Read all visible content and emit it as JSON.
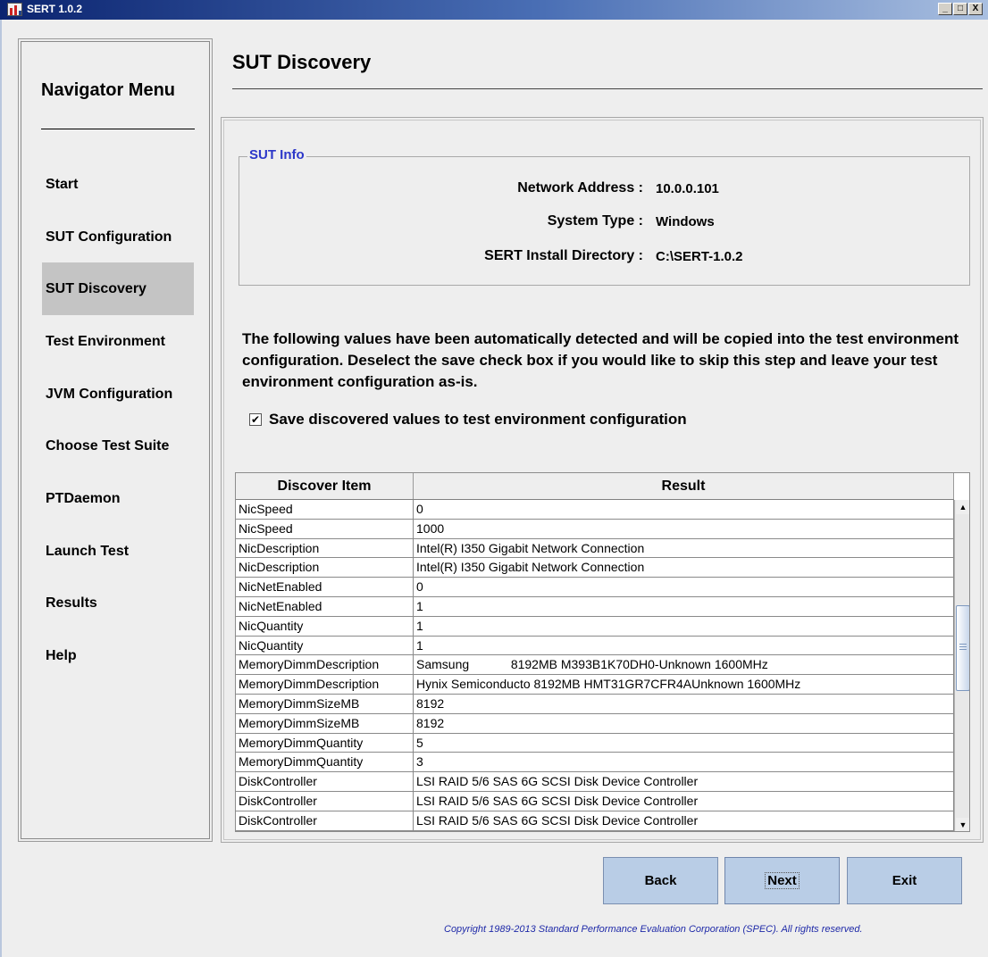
{
  "window": {
    "title": "SERT 1.0.2",
    "minimize": "_",
    "maximize": "□",
    "close": "X"
  },
  "navigator": {
    "heading": "Navigator Menu",
    "items": [
      {
        "label": "Start"
      },
      {
        "label": "SUT Configuration"
      },
      {
        "label": "SUT Discovery"
      },
      {
        "label": "Test Environment"
      },
      {
        "label": "JVM Configuration"
      },
      {
        "label": "Choose Test Suite"
      },
      {
        "label": "PTDaemon"
      },
      {
        "label": "Launch Test"
      },
      {
        "label": "Results"
      },
      {
        "label": "Help"
      }
    ],
    "active_item": "SUT Discovery"
  },
  "page": {
    "title": "SUT Discovery"
  },
  "sut_info": {
    "legend": "SUT Info",
    "network_address_label": "Network Address :",
    "network_address": "10.0.0.101",
    "system_type_label": "System Type :",
    "system_type": "Windows",
    "install_dir_label": "SERT Install Directory :",
    "install_dir": "C:\\SERT-1.0.2"
  },
  "description": "The following values have been automatically detected and will be copied into the test environment configuration. Deselect the save check box if you would like to skip this step and leave your test environment configuration as-is.",
  "save_option": {
    "checked": true,
    "check_mark": "✔",
    "label": "Save discovered values to test environment configuration"
  },
  "table": {
    "columns": [
      "Discover Item",
      "Result"
    ],
    "rows": [
      [
        "NicSpeed",
        "0"
      ],
      [
        "NicSpeed",
        "1000"
      ],
      [
        "NicDescription",
        "Intel(R) I350 Gigabit Network Connection"
      ],
      [
        "NicDescription",
        "Intel(R) I350 Gigabit Network Connection"
      ],
      [
        "NicNetEnabled",
        "0"
      ],
      [
        "NicNetEnabled",
        "1"
      ],
      [
        "NicQuantity",
        "1"
      ],
      [
        "NicQuantity",
        "1"
      ],
      [
        "MemoryDimmDescription",
        "Samsung            8192MB M393B1K70DH0-Unknown 1600MHz"
      ],
      [
        "MemoryDimmDescription",
        "Hynix Semiconducto 8192MB HMT31GR7CFR4AUnknown 1600MHz"
      ],
      [
        "MemoryDimmSizeMB",
        "8192"
      ],
      [
        "MemoryDimmSizeMB",
        "8192"
      ],
      [
        "MemoryDimmQuantity",
        "5"
      ],
      [
        "MemoryDimmQuantity",
        "3"
      ],
      [
        "DiskController",
        "LSI RAID 5/6 SAS 6G SCSI Disk Device Controller"
      ],
      [
        "DiskController",
        "LSI RAID 5/6 SAS 6G SCSI Disk Device Controller"
      ],
      [
        "DiskController",
        "LSI RAID 5/6 SAS 6G SCSI Disk Device Controller"
      ]
    ],
    "scroll_up_glyph": "▲",
    "scroll_down_glyph": "▼"
  },
  "buttons": {
    "back": "Back",
    "next": "Next",
    "exit": "Exit"
  },
  "copyright": "Copyright 1989-2013 Standard Performance Evaluation Corporation (SPEC). All rights reserved.",
  "colors": {
    "legend": "#2c37c9",
    "button_bg": "#b9cde6",
    "nav_active_bg": "#c4c4c4",
    "copyright": "#1f2aa8"
  }
}
